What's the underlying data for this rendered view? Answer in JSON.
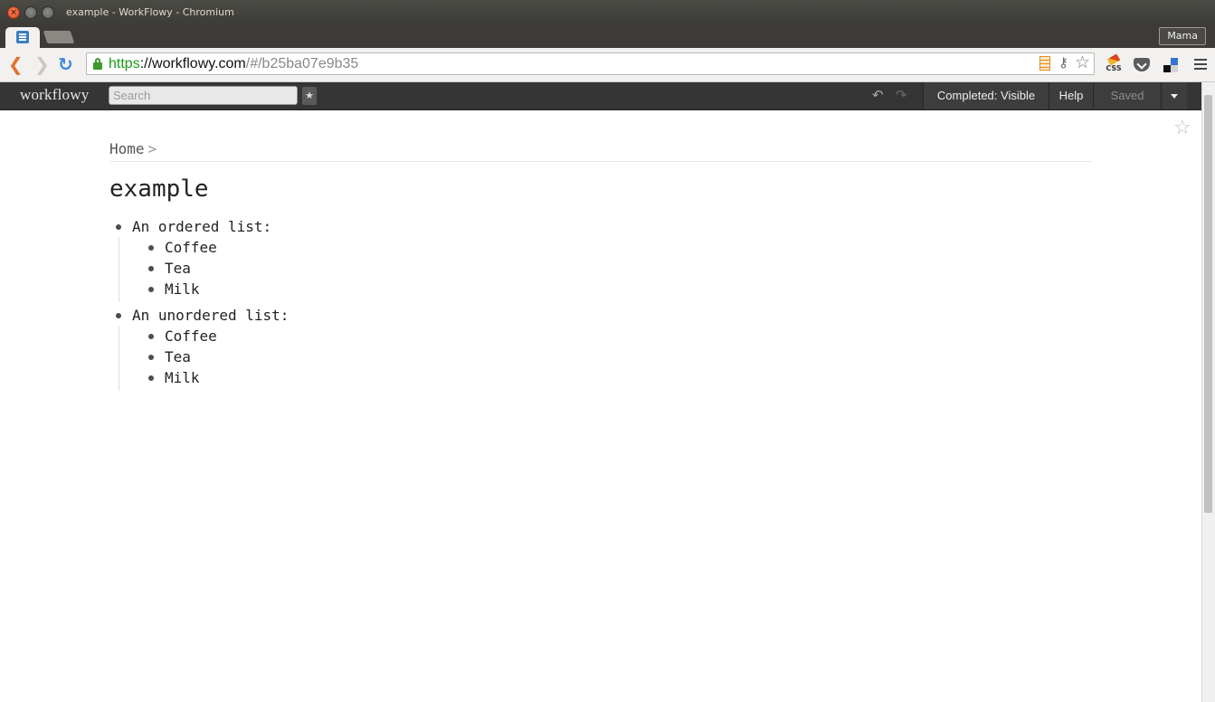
{
  "window": {
    "title": "example - WorkFlowy - Chromium"
  },
  "tabs": {
    "profile_label": "Mama"
  },
  "address_bar": {
    "scheme": "https",
    "host": "://workflowy.com",
    "path": "/#/b25ba07e9b35"
  },
  "workflowy_header": {
    "logo": "workflowy",
    "search_placeholder": "Search",
    "star_glyph": "★",
    "completed_label": "Completed: Visible",
    "help_label": "Help",
    "saved_label": "Saved"
  },
  "breadcrumb": {
    "home": "Home",
    "separator": ">"
  },
  "page": {
    "title": "example",
    "items": [
      {
        "label": "An ordered list:",
        "children": [
          "Coffee",
          "Tea",
          "Milk"
        ]
      },
      {
        "label": "An unordered list:",
        "children": [
          "Coffee",
          "Tea",
          "Milk"
        ]
      }
    ]
  },
  "icons": {
    "back": "chevron-left-icon",
    "forward": "chevron-right-icon",
    "reload": "reload-icon",
    "lock": "lock-icon",
    "bookmark": "star-icon",
    "undo": "undo-icon",
    "redo": "redo-icon"
  },
  "colors": {
    "https_green": "#199a18",
    "header_bg": "#353535",
    "back_orange": "#e2722b"
  }
}
